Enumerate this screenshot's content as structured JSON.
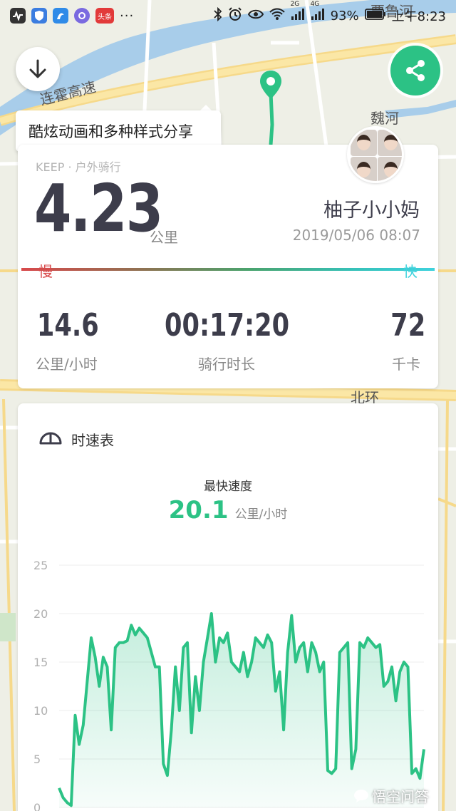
{
  "status_bar": {
    "apps": [
      "activity-app",
      "shield-app",
      "swan-app",
      "browser-app",
      "toutiao-app",
      "more"
    ],
    "toutiao_label": "头条",
    "network_1": "2G",
    "network_2": "4G",
    "battery": "93%",
    "time": "上午8:23"
  },
  "map": {
    "labels": [
      "连霍高速",
      "魏河",
      "贾鲁河",
      "北环"
    ],
    "route_color": "#2cc285"
  },
  "tooltip": {
    "text": "酷炫动画和多种样式分享"
  },
  "summary": {
    "brand": "KEEP · 户外骑行",
    "distance": "4.23",
    "distance_unit": "公里",
    "username": "柚子小小妈",
    "datetime": "2019/05/06 08:07",
    "slow_label": "慢",
    "fast_label": "快",
    "stats": [
      {
        "value": "14.6",
        "label": "公里/小时"
      },
      {
        "value": "00:17:20",
        "label": "骑行时长"
      },
      {
        "value": "72",
        "label": "千卡"
      }
    ]
  },
  "speed_card": {
    "title": "时速表",
    "max_label": "最快速度",
    "max_value": "20.1",
    "max_unit": "公里/小时"
  },
  "chart_data": {
    "type": "area",
    "title": "",
    "xlabel": "",
    "ylabel": "",
    "ylim": [
      0,
      25
    ],
    "yticks": [
      "25",
      "20",
      "15",
      "10",
      "5",
      "0"
    ],
    "grid": true,
    "color": "#2cc285",
    "series": [
      {
        "values": [
          2.0,
          1.0,
          0.5,
          0.2,
          9.5,
          6.5,
          8.5,
          13.0,
          17.5,
          15.5,
          12.5,
          15.5,
          14.5,
          8.0,
          16.5,
          17.0,
          17.0,
          17.2,
          18.8,
          17.8,
          18.5,
          18.0,
          17.5,
          16.0,
          14.5,
          14.5,
          4.5,
          3.3,
          8.0,
          14.5,
          10.0,
          16.5,
          17.0,
          7.7,
          13.5,
          10.0,
          15.0,
          17.5,
          20.0,
          15.0,
          17.5,
          17.0,
          18.0,
          15.0,
          14.5,
          14.0,
          16.0,
          13.5,
          15.0,
          17.5,
          17.0,
          16.5,
          17.8,
          17.0,
          12.0,
          14.0,
          8.0,
          16.0,
          19.8,
          15.0,
          16.5,
          17.0,
          14.0,
          17.0,
          16.0,
          14.0,
          15.0,
          3.8,
          3.5,
          4.0,
          16.0,
          16.5,
          17.0,
          4.0,
          6.0,
          17.0,
          16.5,
          17.5,
          17.0,
          16.5,
          16.8,
          12.5,
          13.0,
          14.5,
          11.0,
          14.0,
          15.0,
          14.5,
          3.5,
          4.0,
          3.0,
          6.0
        ]
      }
    ]
  },
  "watermark": {
    "text": "悟空问答"
  }
}
